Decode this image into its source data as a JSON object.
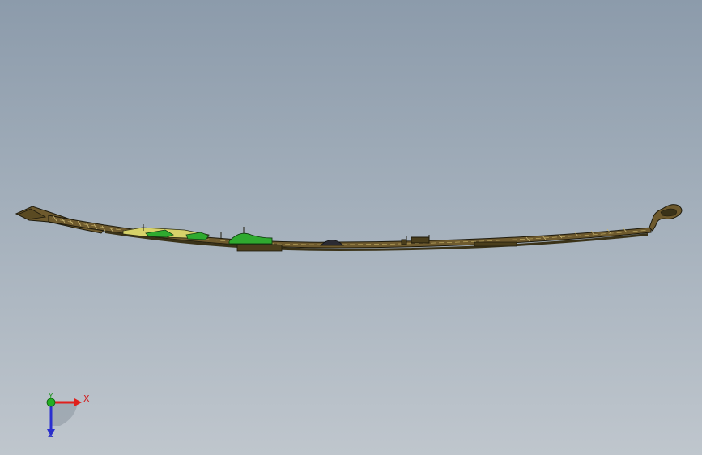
{
  "window": {
    "title": ""
  },
  "viewport": {
    "background_top": "#8c9bab",
    "background_bottom": "#bfc6cd",
    "model_colors": {
      "body": "#6e5a2e",
      "body_dark": "#3a3218",
      "edge": "#1e1a0c",
      "detail_green": "#2faa2f",
      "detail_yellow": "#d7d26a",
      "detail_dark": "#2b2b33"
    }
  },
  "triad": {
    "x_label": "X",
    "y_label": "Y",
    "z_label": "Z",
    "x_color": "#e0201c",
    "y_color": "#22b022",
    "z_color": "#2a2fd0"
  }
}
